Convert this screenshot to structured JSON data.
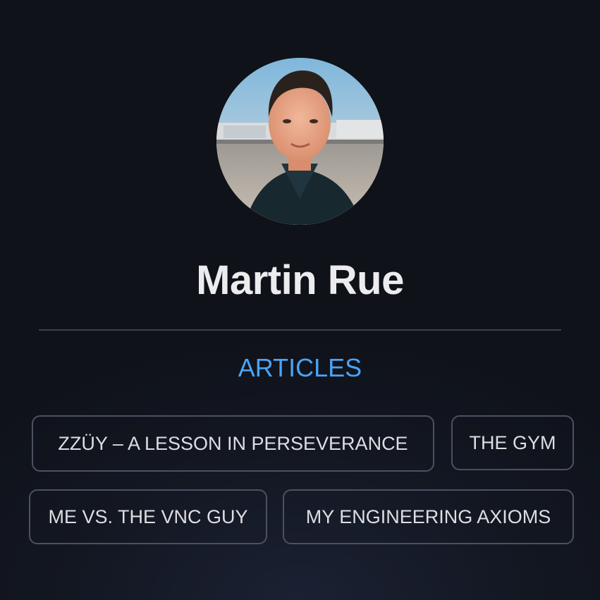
{
  "profile": {
    "name": "Martin Rue",
    "avatar_alt": "profile-photo"
  },
  "articles": {
    "heading": "ARTICLES",
    "items": [
      {
        "label": "ZZÜY – A LESSON IN PERSEVERANCE"
      },
      {
        "label": "THE GYM"
      },
      {
        "label": "ME VS. THE VNC GUY"
      },
      {
        "label": "MY ENGINEERING AXIOMS"
      }
    ]
  },
  "colors": {
    "background": "#10131a",
    "accent": "#4ba3f3",
    "divider": "#3b3f49",
    "tag_border": "#4c5162"
  }
}
